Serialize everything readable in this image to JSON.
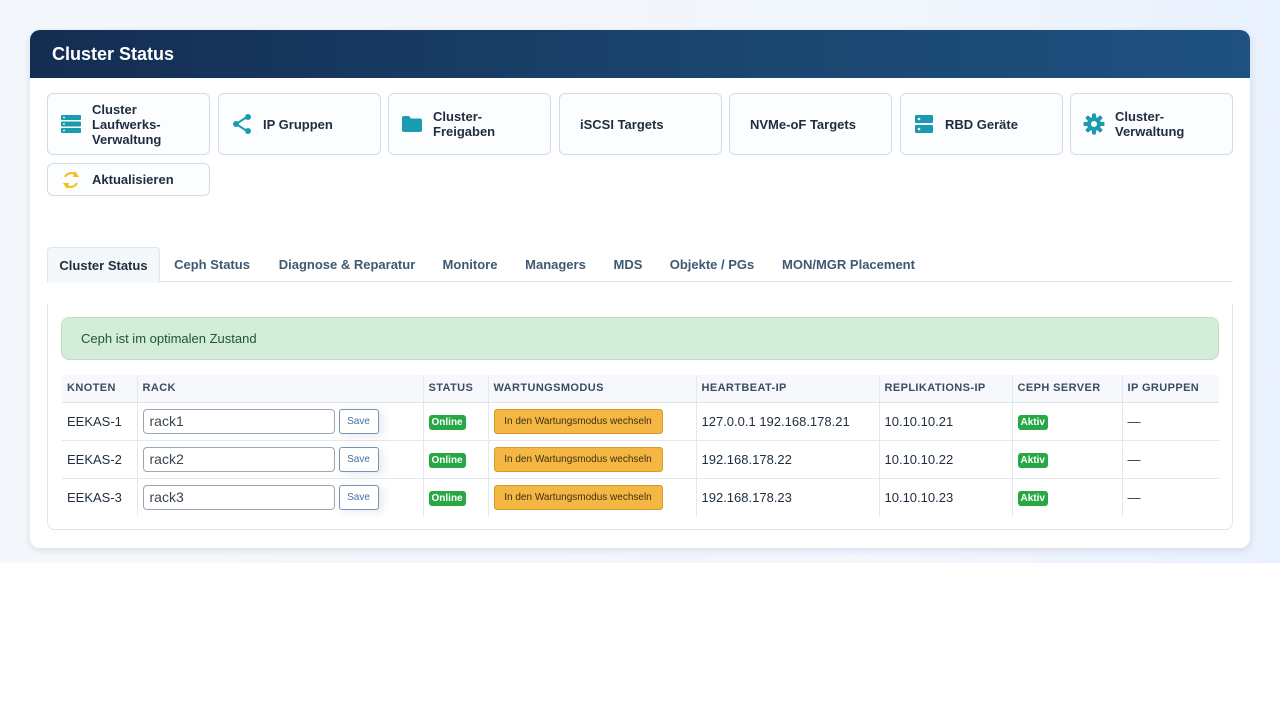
{
  "header": {
    "title": "Cluster Status"
  },
  "tiles": [
    {
      "label": "Cluster Laufwerks-Verwaltung",
      "icon": "server-icon"
    },
    {
      "label": "IP Gruppen",
      "icon": "share-icon"
    },
    {
      "label": "Cluster-Freigaben",
      "icon": "folder-icon"
    },
    {
      "label": "iSCSI Targets",
      "icon": ""
    },
    {
      "label": "NVMe-oF Targets",
      "icon": ""
    },
    {
      "label": "RBD Geräte",
      "icon": "hdd-icon"
    },
    {
      "label": "Cluster-Verwaltung",
      "icon": "gear-icon"
    },
    {
      "label": "Aktualisieren",
      "icon": "refresh-icon"
    }
  ],
  "tabs": [
    {
      "label": "Cluster Status",
      "active": true
    },
    {
      "label": "Ceph Status"
    },
    {
      "label": "Diagnose & Reparatur"
    },
    {
      "label": "Monitore"
    },
    {
      "label": "Managers"
    },
    {
      "label": "MDS"
    },
    {
      "label": "Objekte / PGs"
    },
    {
      "label": "MON/MGR Placement"
    }
  ],
  "alert": {
    "text": "Ceph ist im optimalen Zustand"
  },
  "table": {
    "headers": [
      "KNOTEN",
      "RACK",
      "STATUS",
      "WARTUNGSMODUS",
      "HEARTBEAT-IP",
      "REPLIKATIONS-IP",
      "CEPH SERVER",
      "IP GRUPPEN"
    ],
    "rows": [
      {
        "node": "EEKAS-1",
        "rack": "rack1",
        "save": "Save",
        "status": "Online",
        "maintenance": "In den Wartungsmodus wechseln",
        "heartbeat_ip": "127.0.0.1 192.168.178.21",
        "replication_ip": "10.10.10.21",
        "ceph_server": "Aktiv",
        "ip_groups": "—"
      },
      {
        "node": "EEKAS-2",
        "rack": "rack2",
        "save": "Save",
        "status": "Online",
        "maintenance": "In den Wartungsmodus wechseln",
        "heartbeat_ip": "192.168.178.22",
        "replication_ip": "10.10.10.22",
        "ceph_server": "Aktiv",
        "ip_groups": "—"
      },
      {
        "node": "EEKAS-3",
        "rack": "rack3",
        "save": "Save",
        "status": "Online",
        "maintenance": "In den Wartungsmodus wechseln",
        "heartbeat_ip": "192.168.178.23",
        "replication_ip": "10.10.10.23",
        "ceph_server": "Aktiv",
        "ip_groups": "—"
      }
    ]
  },
  "colors": {
    "header_bg": "#142d52",
    "icon_teal": "#1a9bb0",
    "refresh_yellow": "#f2c012",
    "success_bg": "#d4edda",
    "badge_green": "#28a745",
    "maintenance_orange": "#f5b743"
  }
}
